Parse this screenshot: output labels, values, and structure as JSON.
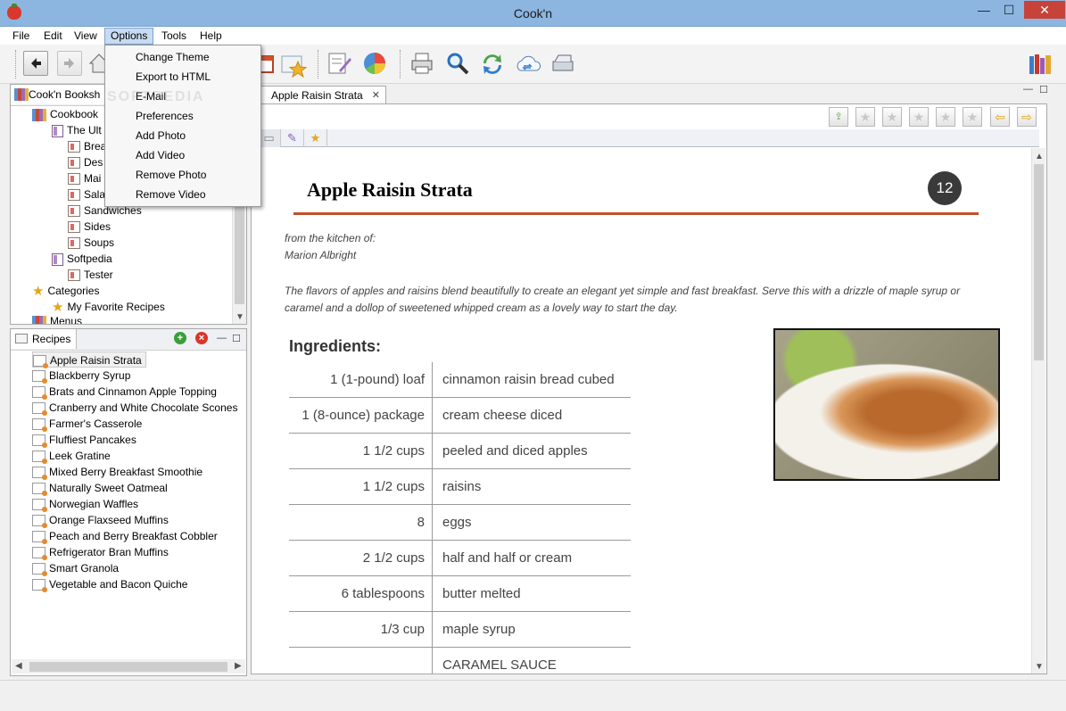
{
  "window": {
    "title": "Cook'n",
    "min": "—",
    "max": "☐",
    "close": "✕"
  },
  "menubar": [
    "File",
    "Edit",
    "View",
    "Options",
    "Tools",
    "Help"
  ],
  "options_menu": [
    "Change Theme",
    "Export to HTML",
    "E-Mail",
    "Preferences",
    "Add Photo",
    "Add Video",
    "Remove Photo",
    "Remove Video"
  ],
  "bookshelf": {
    "tab_label": "Cook'n Booksh",
    "rows": [
      {
        "label": "Cookbook"
      },
      {
        "label": "The Ult"
      },
      {
        "label": "Brea"
      },
      {
        "label": "Des"
      },
      {
        "label": "Mai"
      },
      {
        "label": "Sala"
      },
      {
        "label": "Sandwiches"
      },
      {
        "label": "Sides"
      },
      {
        "label": "Soups"
      },
      {
        "label": "Softpedia"
      },
      {
        "label": "Tester"
      },
      {
        "label": "Categories"
      },
      {
        "label": "My Favorite Recipes"
      },
      {
        "label": "Menus"
      }
    ]
  },
  "recipes_panel": {
    "tab_label": "Recipes",
    "items": [
      "Apple Raisin Strata",
      "Blackberry Syrup",
      "Brats and Cinnamon Apple Topping",
      "Cranberry and White Chocolate Scones",
      "Farmer's Casserole",
      "Fluffiest Pancakes",
      "Leek Gratine",
      "Mixed Berry Breakfast Smoothie",
      "Naturally Sweet Oatmeal",
      "Norwegian Waffles",
      "Orange Flaxseed Muffins",
      "Peach and Berry Breakfast Cobbler",
      "Refrigerator Bran Muffins",
      "Smart Granola",
      "Vegetable and Bacon Quiche"
    ],
    "selected": "Apple Raisin Strata"
  },
  "document": {
    "tab_label": "Apple Raisin Strata",
    "close": "✕"
  },
  "recipe": {
    "title": "Apple Raisin Strata",
    "servings": "12",
    "from_label": "from the kitchen of:",
    "author": "Marion Albright",
    "description": "The flavors of apples and raisins blend beautifully to create an elegant yet simple and fast breakfast. Serve this with a drizzle of maple syrup or caramel and a dollop of sweetened whipped cream as a lovely way to start the day.",
    "ingredients_heading": "Ingredients:",
    "ingredients": [
      {
        "qty": "1 (1-pound) loaf",
        "name": "cinnamon raisin bread cubed"
      },
      {
        "qty": "1 (8-ounce) package",
        "name": "cream cheese diced"
      },
      {
        "qty": "1 1/2 cups",
        "name": "peeled and diced apples"
      },
      {
        "qty": "1 1/2 cups",
        "name": "raisins"
      },
      {
        "qty": "8",
        "name": "eggs"
      },
      {
        "qty": "2 1/2 cups",
        "name": "half and half or cream"
      },
      {
        "qty": "6 tablespoons",
        "name": "butter melted"
      },
      {
        "qty": "1/3 cup",
        "name": "maple syrup"
      },
      {
        "qty": "",
        "name": "CARAMEL SAUCE"
      }
    ]
  },
  "watermark": "SOFTPEDIA",
  "colors": {
    "accent_rule": "#c2502a",
    "title_bar": "#8cb6e0",
    "menu_active": "#c7dcf3"
  }
}
